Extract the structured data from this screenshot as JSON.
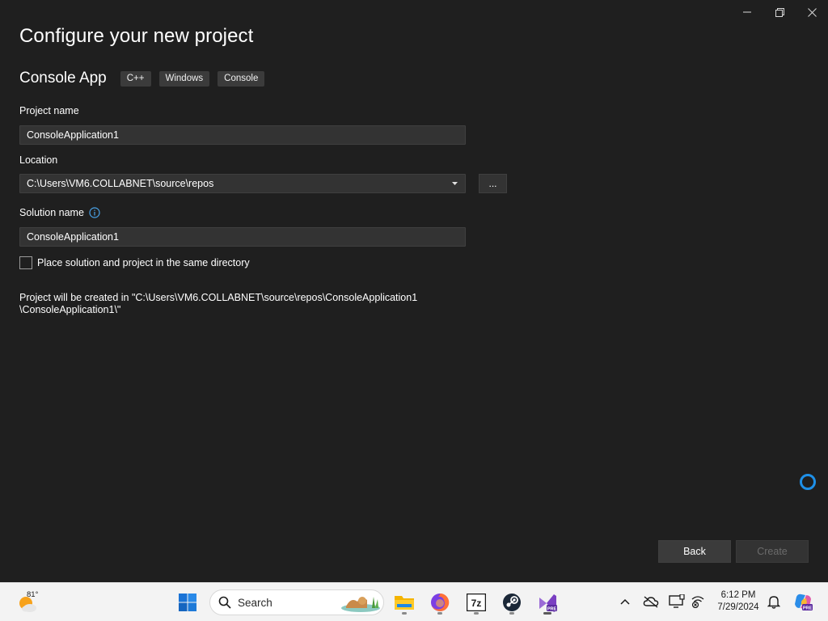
{
  "window": {
    "title": "Configure your new project",
    "controls": [
      "minimize",
      "restore",
      "close"
    ]
  },
  "template": {
    "name": "Console App",
    "tags": [
      "C++",
      "Windows",
      "Console"
    ]
  },
  "form": {
    "project_name_label": "Project name",
    "project_name_value": "ConsoleApplication1",
    "location_label": "Location",
    "location_value": "C:\\Users\\VM6.COLLABNET\\source\\repos",
    "browse_label": "...",
    "solution_name_label": "Solution name",
    "solution_name_value": "ConsoleApplication1",
    "same_dir_label": "Place solution and project in the same directory",
    "same_dir_checked": false,
    "creation_path_line1": "Project will be created in \"C:\\Users\\VM6.COLLABNET\\source\\repos\\ConsoleApplication1",
    "creation_path_line2": "\\ConsoleApplication1\\\""
  },
  "buttons": {
    "back": "Back",
    "create": "Create"
  },
  "taskbar": {
    "weather_temp": "81°",
    "search_placeholder": "Search",
    "apps": [
      "start-icon",
      "file-explorer-icon",
      "firefox-icon",
      "7zip-icon",
      "steam-icon",
      "visual-studio-preview-icon"
    ],
    "time": "6:12 PM",
    "date": "7/29/2024"
  },
  "colors": {
    "background": "#1f1f1f",
    "input_bg": "#333333",
    "accent": "#1e90e8"
  }
}
